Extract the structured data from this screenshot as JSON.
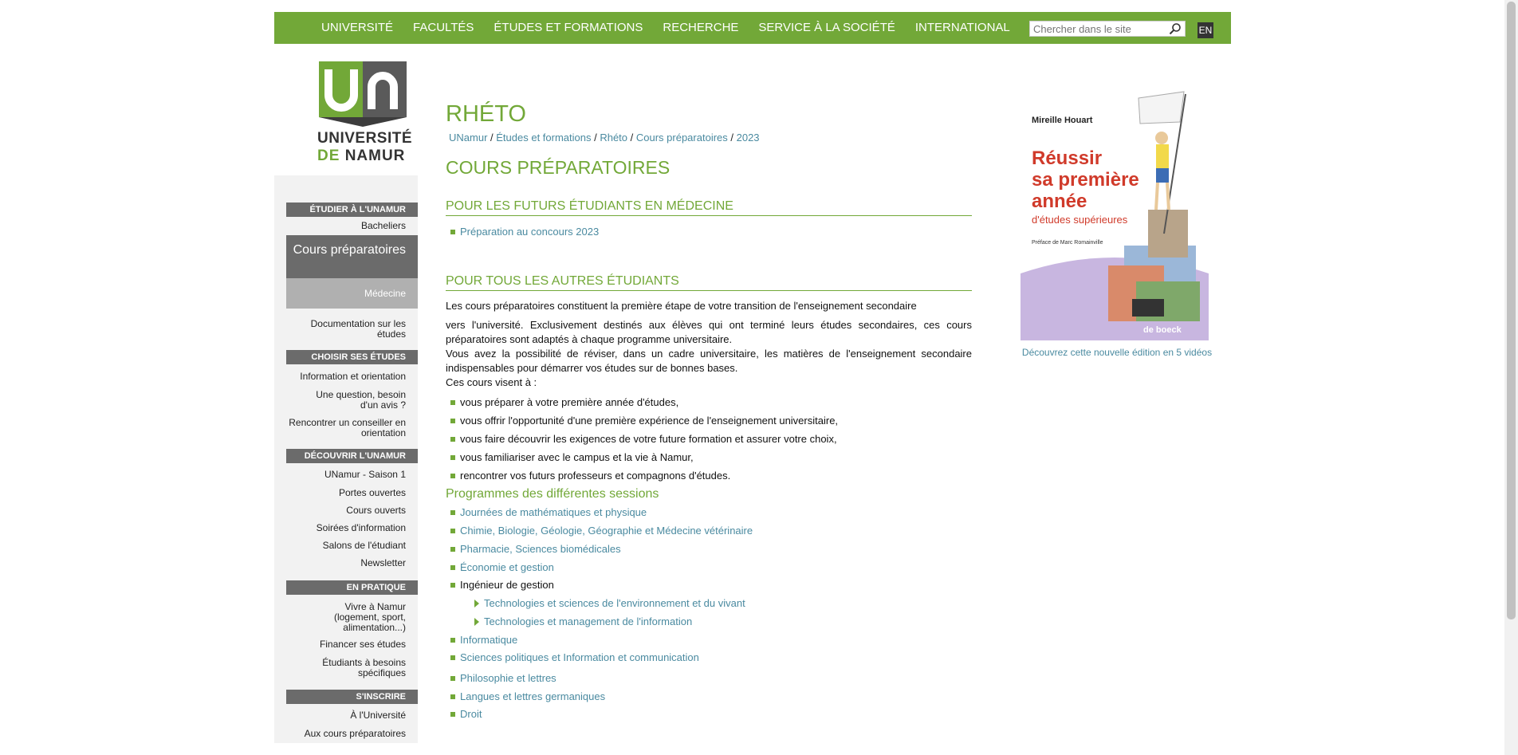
{
  "nav": {
    "items": [
      "UNIVERSITÉ",
      "FACULTÉS",
      "ÉTUDES ET FORMATIONS",
      "RECHERCHE",
      "SERVICE À LA SOCIÉTÉ",
      "INTERNATIONAL"
    ],
    "search_placeholder": "Chercher dans le site",
    "lang": "EN"
  },
  "logo": {
    "line1": "UNIVERSITÉ",
    "de": "DE",
    "namur": "NAMUR"
  },
  "sidebar": {
    "etudier_head": "ÉTUDIER À L'UNAMUR",
    "bacheliers": "Bacheliers",
    "cours_prep": "Cours préparatoires",
    "medecine": "Médecine",
    "documentation": "Documentation sur les études",
    "choisir_head": "CHOISIR SES ÉTUDES",
    "info_orientation": "Information et orientation",
    "question": "Une question, besoin d'un avis ?",
    "rencontrer": "Rencontrer un conseiller en orientation",
    "decouvrir_head": "DÉCOUVRIR L'UNAMUR",
    "saison": "UNamur - Saison 1",
    "portes": "Portes ouvertes",
    "cours_ouverts": "Cours ouverts",
    "soirees": "Soirées d'information",
    "salons": "Salons de l'étudiant",
    "newsletter": "Newsletter",
    "pratique_head": "EN PRATIQUE",
    "vivre": "Vivre à Namur (logement, sport, alimentation...)",
    "financer": "Financer ses études",
    "besoins": "Étudiants à besoins spécifiques",
    "inscrire_head": "S'INSCRIRE",
    "universite": "À l'Université",
    "aux_cours": "Aux cours préparatoires"
  },
  "main": {
    "title": "RHÉTO",
    "breadcrumb": [
      "UNamur",
      "Études et formations",
      "Rhéto",
      "Cours préparatoires",
      "2023"
    ],
    "heading": "COURS PRÉPARATOIRES",
    "section1": "POUR LES FUTURS ÉTUDIANTS EN MÉDECINE",
    "prep_link": "Préparation au concours 2023",
    "section2": "POUR TOUS LES AUTRES ÉTUDIANTS",
    "para1": "Les cours préparatoires constituent la première étape de votre transition de l'enseignement secondaire",
    "para2": "vers l'université. Exclusivement destinés aux élèves qui ont terminé leurs études secondaires, ces cours préparatoires sont adaptés à chaque programme universitaire.",
    "para3": "Vous avez la possibilité de réviser, dans un cadre universitaire, les matières de l'enseignement secondaire indispensables pour démarrer vos études sur de bonnes bases.",
    "para4": "Ces cours visent à :",
    "aims": [
      "vous préparer à votre première année d'études,",
      "vous offrir l'opportunité d'une première expérience de l'enseignement universitaire,",
      "vous faire découvrir les exigences de votre future formation et assurer votre choix,",
      "vous familiariser avec le campus et la vie à Namur,",
      "rencontrer vos futurs professeurs et compagnons d'études."
    ],
    "programmes_title": "Programmes des différentes sessions",
    "programmes": [
      "Journées de mathématiques et physique",
      "Chimie, Biologie, Géologie, Géographie et Médecine vétérinaire",
      "Pharmacie, Sciences biomédicales",
      "Économie et gestion",
      "Ingénieur de gestion",
      "Technologies et sciences de l'environnement et du vivant",
      "Technologies et management de l'information",
      "Informatique",
      "Sciences politiques et Information et communication",
      "Philosophie et lettres",
      "Langues et lettres germaniques",
      "Droit"
    ]
  },
  "book": {
    "author": "Mireille Houart",
    "title1": "Réussir",
    "title2": "sa première",
    "title3": "année",
    "subtitle": "d'études supérieures",
    "preface": "Préface de Marc Romainville",
    "publisher": "de boeck",
    "caption": "Découvrez cette nouvelle édition en 5 vidéos"
  }
}
